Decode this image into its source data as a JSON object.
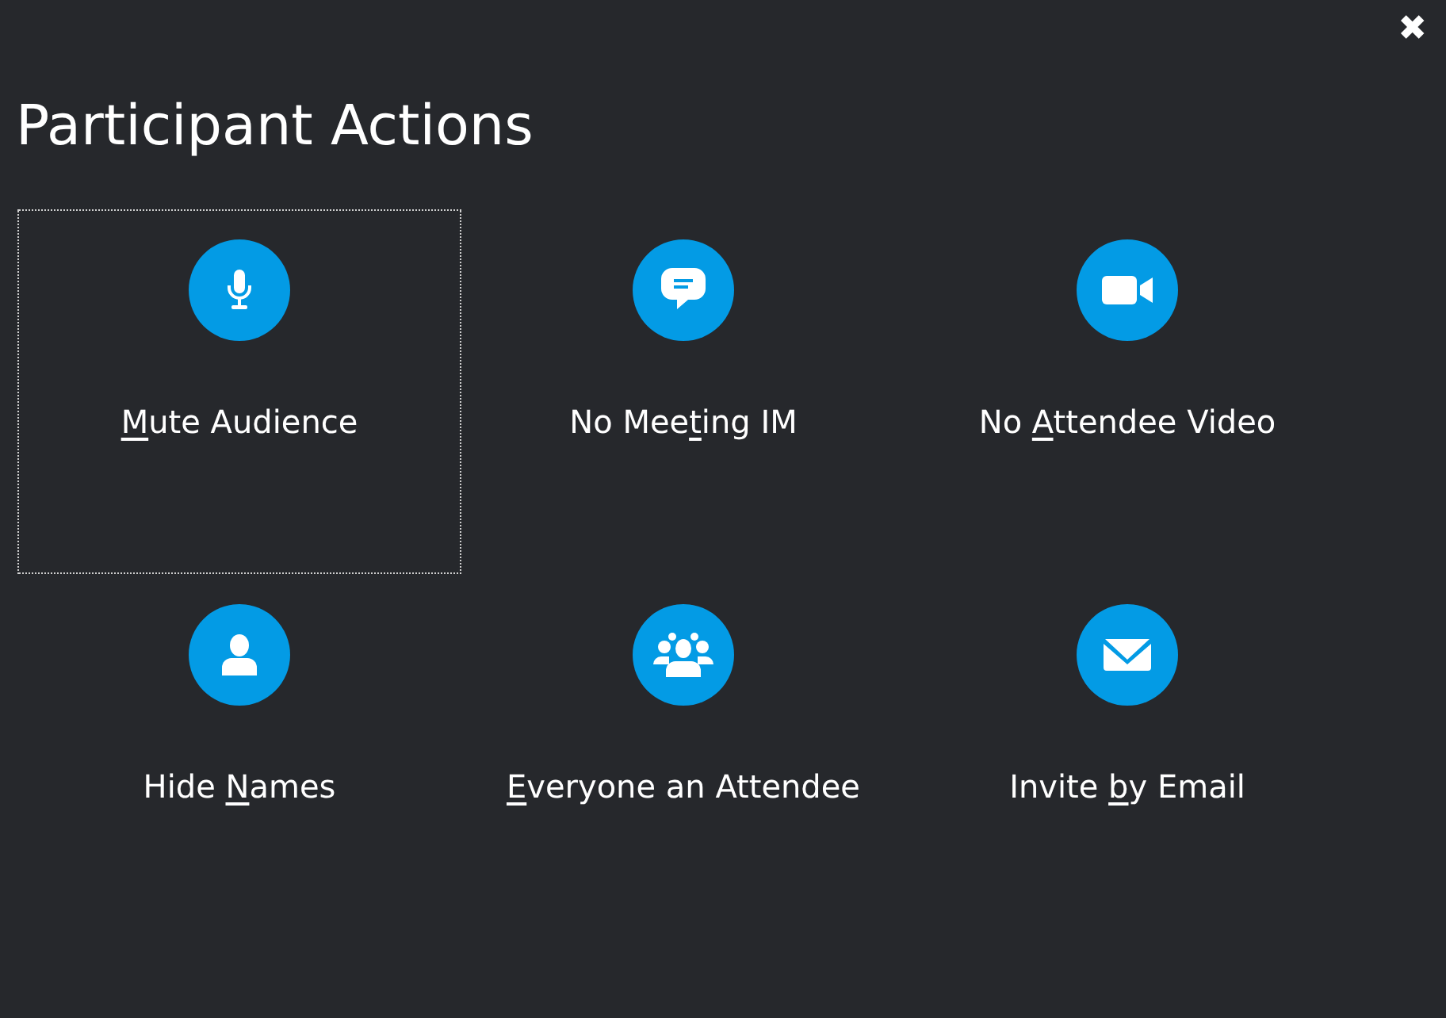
{
  "close_button": {
    "glyph": "✖"
  },
  "title": "Participant Actions",
  "actions": [
    {
      "kind": "microphone",
      "access_key": "M",
      "label_after": "ute Audience",
      "focused": true
    },
    {
      "kind": "chat",
      "label_before": "No Mee",
      "access_key": "t",
      "label_after": "ing IM",
      "focused": false
    },
    {
      "kind": "video",
      "label_before": "No ",
      "access_key": "A",
      "label_after": "ttendee Video",
      "focused": false
    },
    {
      "kind": "person",
      "label_before": "Hide ",
      "access_key": "N",
      "label_after": "ames",
      "focused": false
    },
    {
      "kind": "group",
      "access_key": "E",
      "label_after": "veryone an Attendee",
      "focused": false
    },
    {
      "kind": "mail",
      "label_before": "Invite ",
      "access_key": "b",
      "label_after": "y Email",
      "focused": false
    }
  ]
}
